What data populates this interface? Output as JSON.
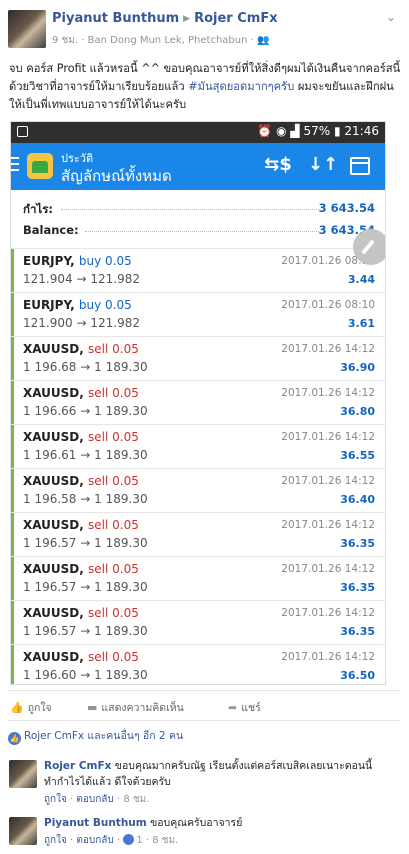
{
  "header": {
    "author": "Piyanut Bunthum",
    "recipient": "Rojer CmFx",
    "time": "9 ชม.",
    "location": "Ban Dong Mun Lek, Phetchabun",
    "audience_icon": "friends-icon"
  },
  "post": {
    "text": "จบ คอร์ส Profit แล้วหรอนี้ ^^ ขอบคุณอาจารย์ที่ให้สิ่งดีๆผมได้เงินคืนจากคอร์สนี้ด้วยวิชาที่อาจารย์ให้มาเรียบร้อยแล้ว ",
    "hashtag": "#มันสุดยอดมากๆครับ",
    "text_end": " ผมจะขยันและฝึกฝนให้เป็นพี่เทพแบบอาจารย์ให้ได้นะครับ"
  },
  "phone": {
    "status": {
      "battery": "57%",
      "time": "21:46"
    },
    "toolbar": {
      "subtitle": "ประวัติ",
      "title": "สัญลักษณ์ทั้งหมด"
    },
    "summary": {
      "profit_label": "กำไร:",
      "profit_value": "3 643.54",
      "balance_label": "Balance:",
      "balance_value": "3 643.54"
    },
    "trades": [
      {
        "symbol": "EURJPY,",
        "side": "buy 0.05",
        "type": "buy",
        "open": "121.904",
        "close": "121.982",
        "date": "2017.01.26 08:10",
        "profit": "3.44"
      },
      {
        "symbol": "EURJPY,",
        "side": "buy 0.05",
        "type": "buy",
        "open": "121.900",
        "close": "121.982",
        "date": "2017.01.26 08:10",
        "profit": "3.61"
      },
      {
        "symbol": "XAUUSD,",
        "side": "sell 0.05",
        "type": "sell",
        "open": "1 196.68",
        "close": "1 189.30",
        "date": "2017.01.26 14:12",
        "profit": "36.90"
      },
      {
        "symbol": "XAUUSD,",
        "side": "sell 0.05",
        "type": "sell",
        "open": "1 196.66",
        "close": "1 189.30",
        "date": "2017.01.26 14:12",
        "profit": "36.80"
      },
      {
        "symbol": "XAUUSD,",
        "side": "sell 0.05",
        "type": "sell",
        "open": "1 196.61",
        "close": "1 189.30",
        "date": "2017.01.26 14:12",
        "profit": "36.55"
      },
      {
        "symbol": "XAUUSD,",
        "side": "sell 0.05",
        "type": "sell",
        "open": "1 196.58",
        "close": "1 189.30",
        "date": "2017.01.26 14:12",
        "profit": "36.40"
      },
      {
        "symbol": "XAUUSD,",
        "side": "sell 0.05",
        "type": "sell",
        "open": "1 196.57",
        "close": "1 189.30",
        "date": "2017.01.26 14:12",
        "profit": "36.35"
      },
      {
        "symbol": "XAUUSD,",
        "side": "sell 0.05",
        "type": "sell",
        "open": "1 196.57",
        "close": "1 189.30",
        "date": "2017.01.26 14:12",
        "profit": "36.35"
      },
      {
        "symbol": "XAUUSD,",
        "side": "sell 0.05",
        "type": "sell",
        "open": "1 196.57",
        "close": "1 189.30",
        "date": "2017.01.26 14:12",
        "profit": "36.35"
      },
      {
        "symbol": "XAUUSD,",
        "side": "sell 0.05",
        "type": "sell",
        "open": "1 196.60",
        "close": "1 189.30",
        "date": "2017.01.26 14:12",
        "profit": "36.50"
      }
    ]
  },
  "actions": {
    "like": "ถูกใจ",
    "comment": "แสดงความคิดเห็น",
    "share": "แชร์"
  },
  "likes_summary": {
    "text": "Rojer CmFx และคนอื่นๆ อีก 2 คน"
  },
  "comments": [
    {
      "name": "Rojer CmFx",
      "text": "ขอบคุณมากครับณัฐ เรียนตั้งแต่คอร์สเบสิคเลยเนาะตอนนี้ทำกำไรได้แล้ว ดีใจด้วยครับ",
      "like": "ถูกใจ",
      "reply": "ตอบกลับ",
      "time": "8 ชม."
    },
    {
      "name": "Piyanut Bunthum",
      "text": "ขอบคุณครับอาจารย์",
      "like": "ถูกใจ",
      "reply": "ตอบกลับ",
      "like_count": "1",
      "time": "8 ชม."
    }
  ],
  "colors": {
    "fb_link": "#365899",
    "mt_blue": "#1a86e8",
    "buy": "#1565c0",
    "sell": "#d32f2f",
    "row_bar": "#7ab648"
  }
}
